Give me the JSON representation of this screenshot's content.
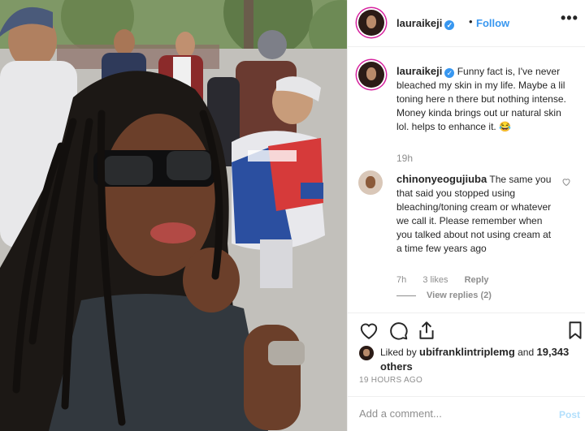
{
  "post": {
    "username": "lauraikeji",
    "follow_label": "Follow",
    "separator": "•",
    "more_label": "•••",
    "caption": {
      "username": "lauraikeji",
      "text": "Funny fact is, I've never bleached my skin in my life. Maybe a lil toning here n there but nothing intense. Money kinda brings out ur natural skin lol. helps to enhance it. 😂",
      "time": "19h"
    },
    "comment": {
      "username": "chinonyeogujiuba",
      "text": "The same you that said you stopped using bleaching/toning cream or whatever we call it. Please remember when you talked about not using cream at a time few years ago",
      "time": "7h",
      "likes": "3 likes",
      "reply_label": "Reply",
      "view_replies": "View replies (2)"
    },
    "liked_by": {
      "prefix": "Liked by",
      "user": "ubifranklintriplemg",
      "and": "and",
      "others": "19,343 others"
    },
    "timestamp": "19 HOURS AGO",
    "add_comment_placeholder": "Add a comment...",
    "post_label": "Post"
  },
  "icons": {
    "heart": "heart-icon",
    "comment": "comment-icon",
    "share": "share-icon",
    "bookmark": "bookmark-icon",
    "verified": "verified-badge-icon"
  },
  "colors": {
    "link_blue": "#3897f0",
    "secondary_text": "#8e8e8e",
    "post_disabled": "#b2dffc",
    "story_ring": "#d6249f"
  }
}
